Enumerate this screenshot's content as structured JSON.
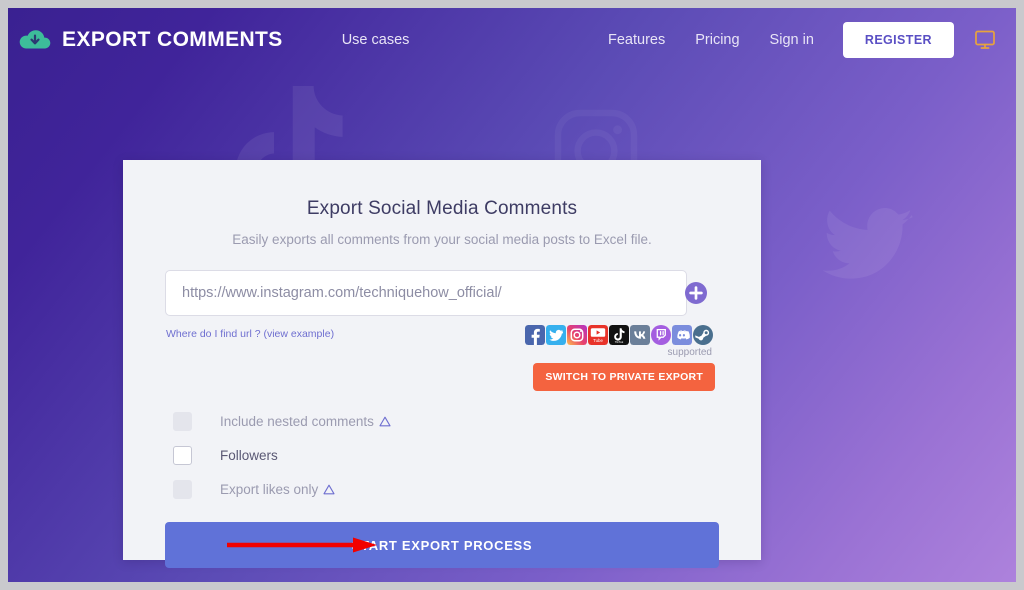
{
  "theme": {
    "bg_gradient_from": "#3a2191",
    "bg_gradient_to": "#ad82dc",
    "card_bg": "#f2f3f7",
    "accent_blue": "#6072d8",
    "accent_orange": "#f4633f",
    "logo_teal": "#3dbd9a",
    "monitor_icon_gold": "#e8a33d",
    "annotation_red": "#f20000"
  },
  "header": {
    "brand": {
      "name_light": "EXPORT",
      "name_bold": "COMMENTS",
      "logo_icon": "cloud-download-icon"
    },
    "nav_left": [
      {
        "label": "Use cases",
        "name": "use-cases"
      }
    ],
    "nav_right": [
      {
        "label": "Features",
        "name": "features"
      },
      {
        "label": "Pricing",
        "name": "pricing"
      },
      {
        "label": "Sign in",
        "name": "sign-in"
      }
    ],
    "register_label": "REGISTER",
    "monitor_icon": "monitor-icon"
  },
  "watermarks": [
    {
      "name": "tiktok-watermark-icon"
    },
    {
      "name": "twitter-watermark-icon"
    },
    {
      "name": "instagram-watermark-icon"
    }
  ],
  "card": {
    "title": "Export Social Media Comments",
    "subtitle": "Easily exports all comments from your social media posts to Excel file.",
    "url_field": {
      "value": "",
      "placeholder": "https://www.instagram.com/techniquehow_official/",
      "add_icon": "plus-circle-icon"
    },
    "find_url_link": "Where do I find url ? (view example)",
    "supported_label": "supported",
    "private_export_label": "SWITCH TO PRIVATE EXPORT",
    "supported_networks": [
      {
        "label": "Facebook",
        "icon": "facebook-icon",
        "color": "#4a66ad"
      },
      {
        "label": "Twitter",
        "icon": "twitter-icon",
        "color": "#36b0ee"
      },
      {
        "label": "Instagram",
        "icon": "instagram-icon",
        "color": "#d6306e"
      },
      {
        "label": "YouTube",
        "icon": "youtube-icon",
        "color": "#e8332a"
      },
      {
        "label": "TikTok",
        "icon": "tiktok-icon",
        "color": "#111111"
      },
      {
        "label": "VK",
        "icon": "vk-icon",
        "color": "#6b7f99"
      },
      {
        "label": "Twitch",
        "icon": "twitch-icon",
        "color": "#a45ee0"
      },
      {
        "label": "Discord",
        "icon": "discord-icon",
        "color": "#7b8ddd"
      },
      {
        "label": "Steam",
        "icon": "steam-icon",
        "color": "#4a6f8e"
      }
    ],
    "options": [
      {
        "label": "Include nested comments",
        "checked": false,
        "disabled": true,
        "warning": true
      },
      {
        "label": "Followers",
        "checked": false,
        "disabled": false,
        "warning": false
      },
      {
        "label": "Export likes only",
        "checked": false,
        "disabled": true,
        "warning": true
      }
    ],
    "submit_label": "START EXPORT PROCESS"
  },
  "annotation": {
    "arrow": "red-arrow-pointing-right"
  }
}
